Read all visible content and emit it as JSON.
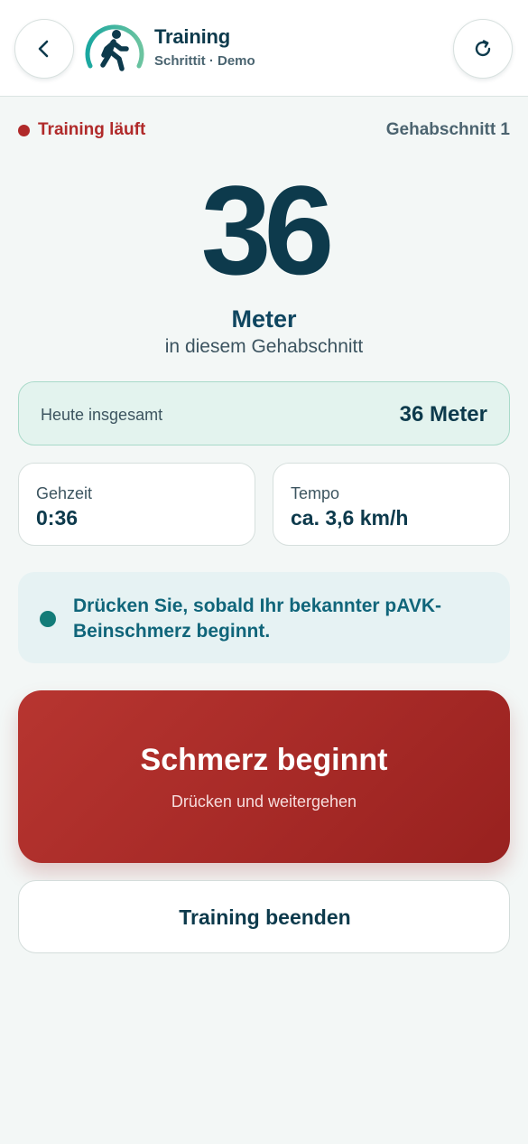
{
  "header": {
    "title": "Training",
    "subtitle": "Schrittit · Demo",
    "back_icon": "chevron-left-icon",
    "refresh_icon": "refresh-icon",
    "logo_icon": "walking-person-icon"
  },
  "status": {
    "text": "Training läuft",
    "segment": "Gehabschnitt 1",
    "color": "#b02a2a"
  },
  "distance": {
    "value": "36",
    "unit": "Meter",
    "caption": "in diesem Gehabschnitt"
  },
  "today": {
    "label": "Heute insgesamt",
    "value": "36 Meter"
  },
  "stats": {
    "time_label": "Gehzeit",
    "time_value": "0:36",
    "pace_label": "Tempo",
    "pace_value": "ca. 3,6 km/h"
  },
  "hint": {
    "text": "Drücken Sie, sobald Ihr bekannter pAVK-Beinschmerz beginnt."
  },
  "actions": {
    "pain_title": "Schmerz beginnt",
    "pain_sub": "Drücken und weitergehen",
    "end_label": "Training beenden"
  },
  "colors": {
    "brand_dark": "#0d3a4c",
    "accent_teal": "#137c78",
    "alert_red": "#b02a2a"
  }
}
